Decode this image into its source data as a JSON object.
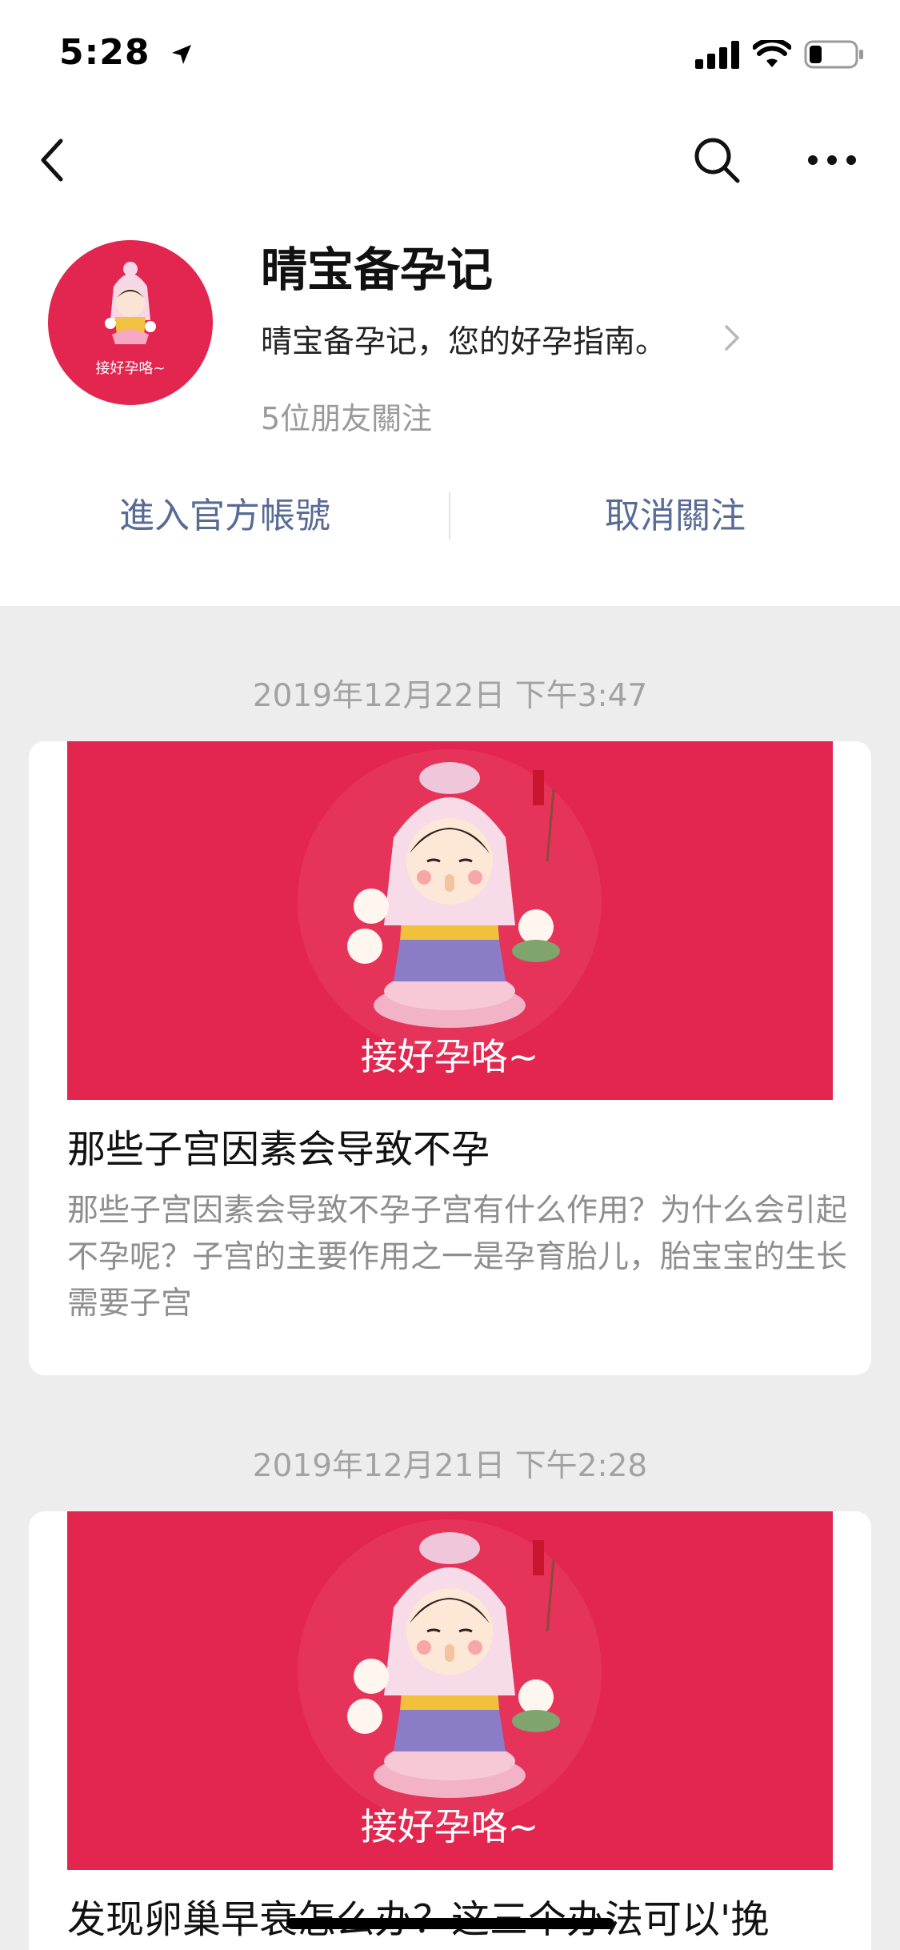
{
  "status_bar": {
    "time": "5:28"
  },
  "navigation": {
    "back_icon": "chevron-left-icon",
    "search_icon": "search-icon",
    "more_icon": "more-dots-icon"
  },
  "account": {
    "name": "晴宝备孕记",
    "description": "晴宝备孕记，您的好孕指南。",
    "followers": "5位朋友關注",
    "avatar_caption": "接好孕咯~",
    "brand_color": "#e3264f"
  },
  "actions": {
    "enter_label": "進入官方帳號",
    "unfollow_label": "取消關注",
    "link_color": "#576b95"
  },
  "articles": [
    {
      "timestamp": "2019年12月22日 下午3:47",
      "cover_caption": "接好孕咯~",
      "title": "那些子宫因素会导致不孕",
      "summary": "那些子宫因素会导致不孕子宫有什么作用？为什么会引起不孕呢？子宫的主要作用之一是孕育胎儿，胎宝宝的生长需要子宫"
    },
    {
      "timestamp": "2019年12月21日 下午2:28",
      "cover_caption": "接好孕咯~",
      "title": "发现卵巢早衰怎么办？这三个办法可以'挽"
    }
  ]
}
